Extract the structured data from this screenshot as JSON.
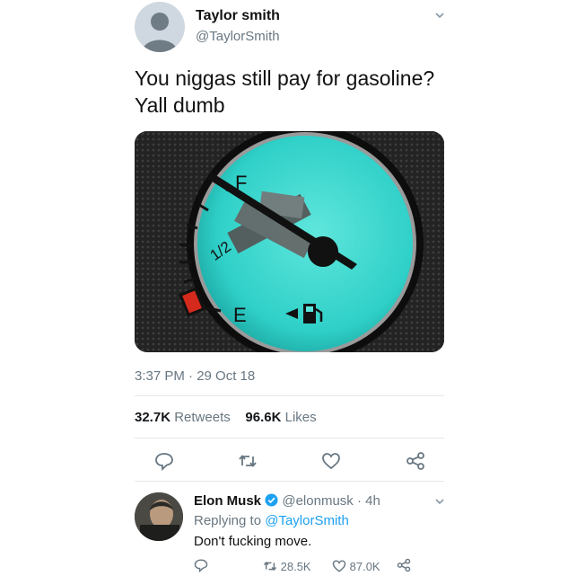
{
  "tweet": {
    "author_name": "Taylor smith",
    "author_handle": "@TaylorSmith",
    "text_line1": "You niggas still pay for gasoline?",
    "text_line2": "Yall dumb",
    "timestamp": "3:37 PM · 29 Oct 18",
    "retweets_count": "32.7K",
    "retweets_label": "Retweets",
    "likes_count": "96.6K",
    "likes_label": "Likes",
    "media": {
      "gauge_full_label": "F",
      "gauge_half_label": "1/2",
      "gauge_empty_label": "E",
      "gauge_face_color": "#2fd0c8"
    }
  },
  "reply": {
    "author_name": "Elon Musk",
    "author_handle": "@elonmusk",
    "time": "· 4h",
    "replying_prefix": "Replying to",
    "replying_to": "@TaylorSmith",
    "text": "Don't fucking move.",
    "retweets": "28.5K",
    "likes": "87.0K"
  },
  "icons": [
    "chevron-down-icon",
    "reply-icon",
    "retweet-icon",
    "like-icon",
    "share-icon",
    "verified-badge-icon"
  ],
  "colors": {
    "accent": "#1da1f2",
    "secondary_text": "#687782"
  }
}
